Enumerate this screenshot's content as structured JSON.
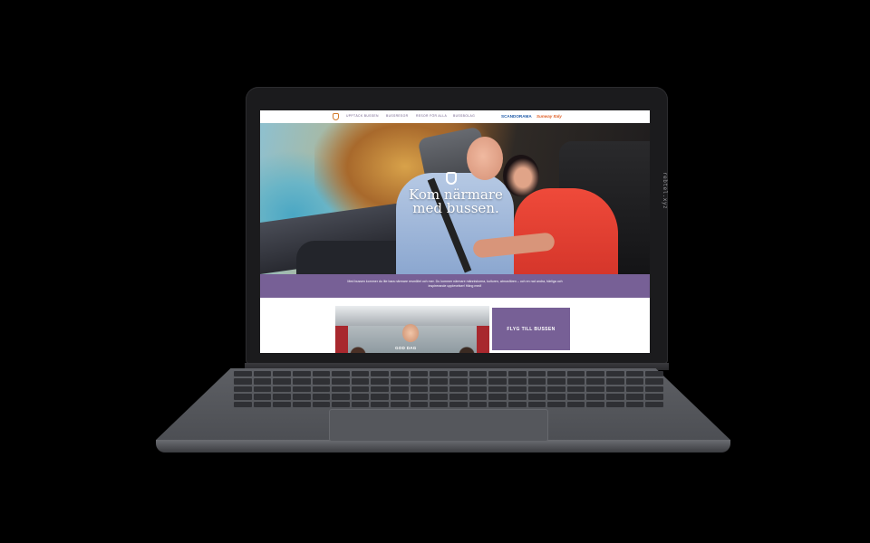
{
  "device": {
    "lid_label": "rebtel.xyz"
  },
  "nav": {
    "logo": "bus-logo-icon",
    "items": [
      "UPPTÄCK BUSSEN",
      "BUSSRESOR",
      "RESOR FÖR ALLA",
      "BUSSBOLAG"
    ],
    "brands": [
      "SCANDORAMA",
      "Sunway Italy"
    ],
    "colors": {
      "item": "#6b5a86",
      "brand1": "#1e5aa8",
      "brand2": "#e0622a"
    }
  },
  "hero": {
    "title": "Kom närmare med bussen.",
    "logo": "bus-logo-icon"
  },
  "band": {
    "text": "Med bussen kommer du lite bara närmare resmålet och mer. Du kommer närmare människorna, kulturen, atmosfären – och en rad andra, härliga och inspirerande upplevelser! Häng med!",
    "color": "#776096"
  },
  "tiles": {
    "photo_label": "GOD DAG",
    "cta_label": "FLYG TILL BUSSEN"
  }
}
